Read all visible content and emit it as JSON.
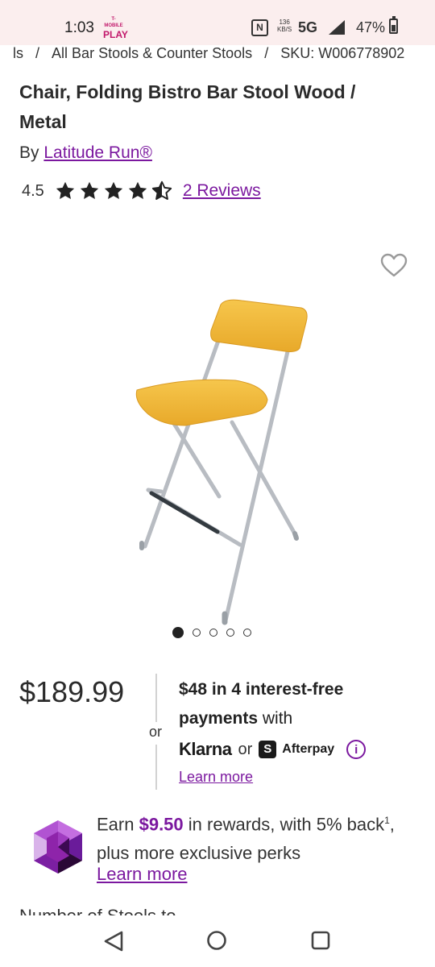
{
  "status_bar": {
    "time": "1:03",
    "carrier_top": "T-MOBILE",
    "carrier_bottom": "PLAY",
    "nfc": "N",
    "speed_value": "136",
    "speed_unit": "KB/S",
    "network": "5G",
    "battery": "47%"
  },
  "breadcrumb": {
    "items": [
      "ls",
      "All Bar Stools & Counter Stools",
      "SKU: W006778902"
    ],
    "separator": "/"
  },
  "product": {
    "title": "Chair, Folding Bistro Bar Stool Wood / Metal",
    "by_label": "By",
    "brand": "Latitude Run®",
    "rating": "4.5",
    "rating_value": 4.5,
    "reviews_link": "2 Reviews",
    "image_count": 5,
    "active_image_index": 0
  },
  "pricing": {
    "price": "$189.99",
    "or_label": "or",
    "installments_bold": "$48 in 4 interest-free payments",
    "installments_rest": " with",
    "klarna_label": "Klarna",
    "pay_or": "or",
    "afterpay_mark": "S",
    "afterpay_label": "Afterpay",
    "info_glyph": "i",
    "learn_more": "Learn more"
  },
  "rewards": {
    "text_before": "Earn ",
    "amount": "$9.50",
    "text_after": " in rewards, with 5% back",
    "superscript": "1",
    "text_end": ", plus more exclusive perks",
    "learn_more": "Learn more"
  },
  "next_section": {
    "title": "Number of Stools to..."
  },
  "colors": {
    "accent": "#7b189f",
    "status_bar_bg": "#fbeeee",
    "text": "#2b2b2b",
    "stool_wood": "#f0b93a",
    "stool_frame": "#b8bcc2"
  },
  "icons": {
    "favorite": "heart-outline-icon",
    "info": "info-circle-icon",
    "nav_back": "triangle-back-icon",
    "nav_home": "circle-home-icon",
    "nav_recents": "square-recents-icon"
  }
}
